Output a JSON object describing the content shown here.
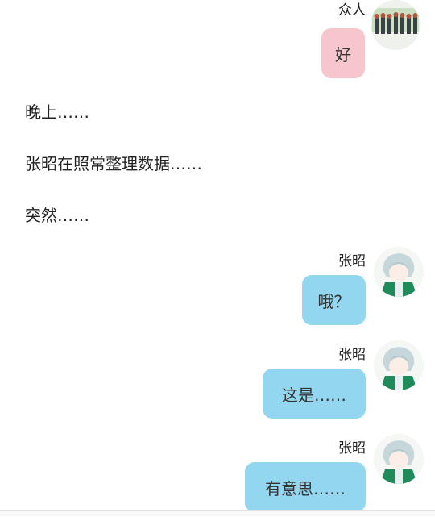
{
  "messages": [
    {
      "sender": "众人",
      "text": "好",
      "style": "pink"
    },
    {
      "sender": "张昭",
      "text": "哦？",
      "style": "blue"
    },
    {
      "sender": "张昭",
      "text": "这是……",
      "style": "blue"
    },
    {
      "sender": "张昭",
      "text": "有意思……",
      "style": "blue"
    }
  ],
  "narration": [
    "晚上……",
    "张昭在照常整理数据……",
    "突然……"
  ],
  "colors": {
    "bubble_pink": "#f6c6cc",
    "bubble_blue": "#92d7ef",
    "background": "#ffffff"
  },
  "icons": {
    "group_avatar": "group-avatar-icon",
    "character_avatar": "anime-character-icon"
  }
}
